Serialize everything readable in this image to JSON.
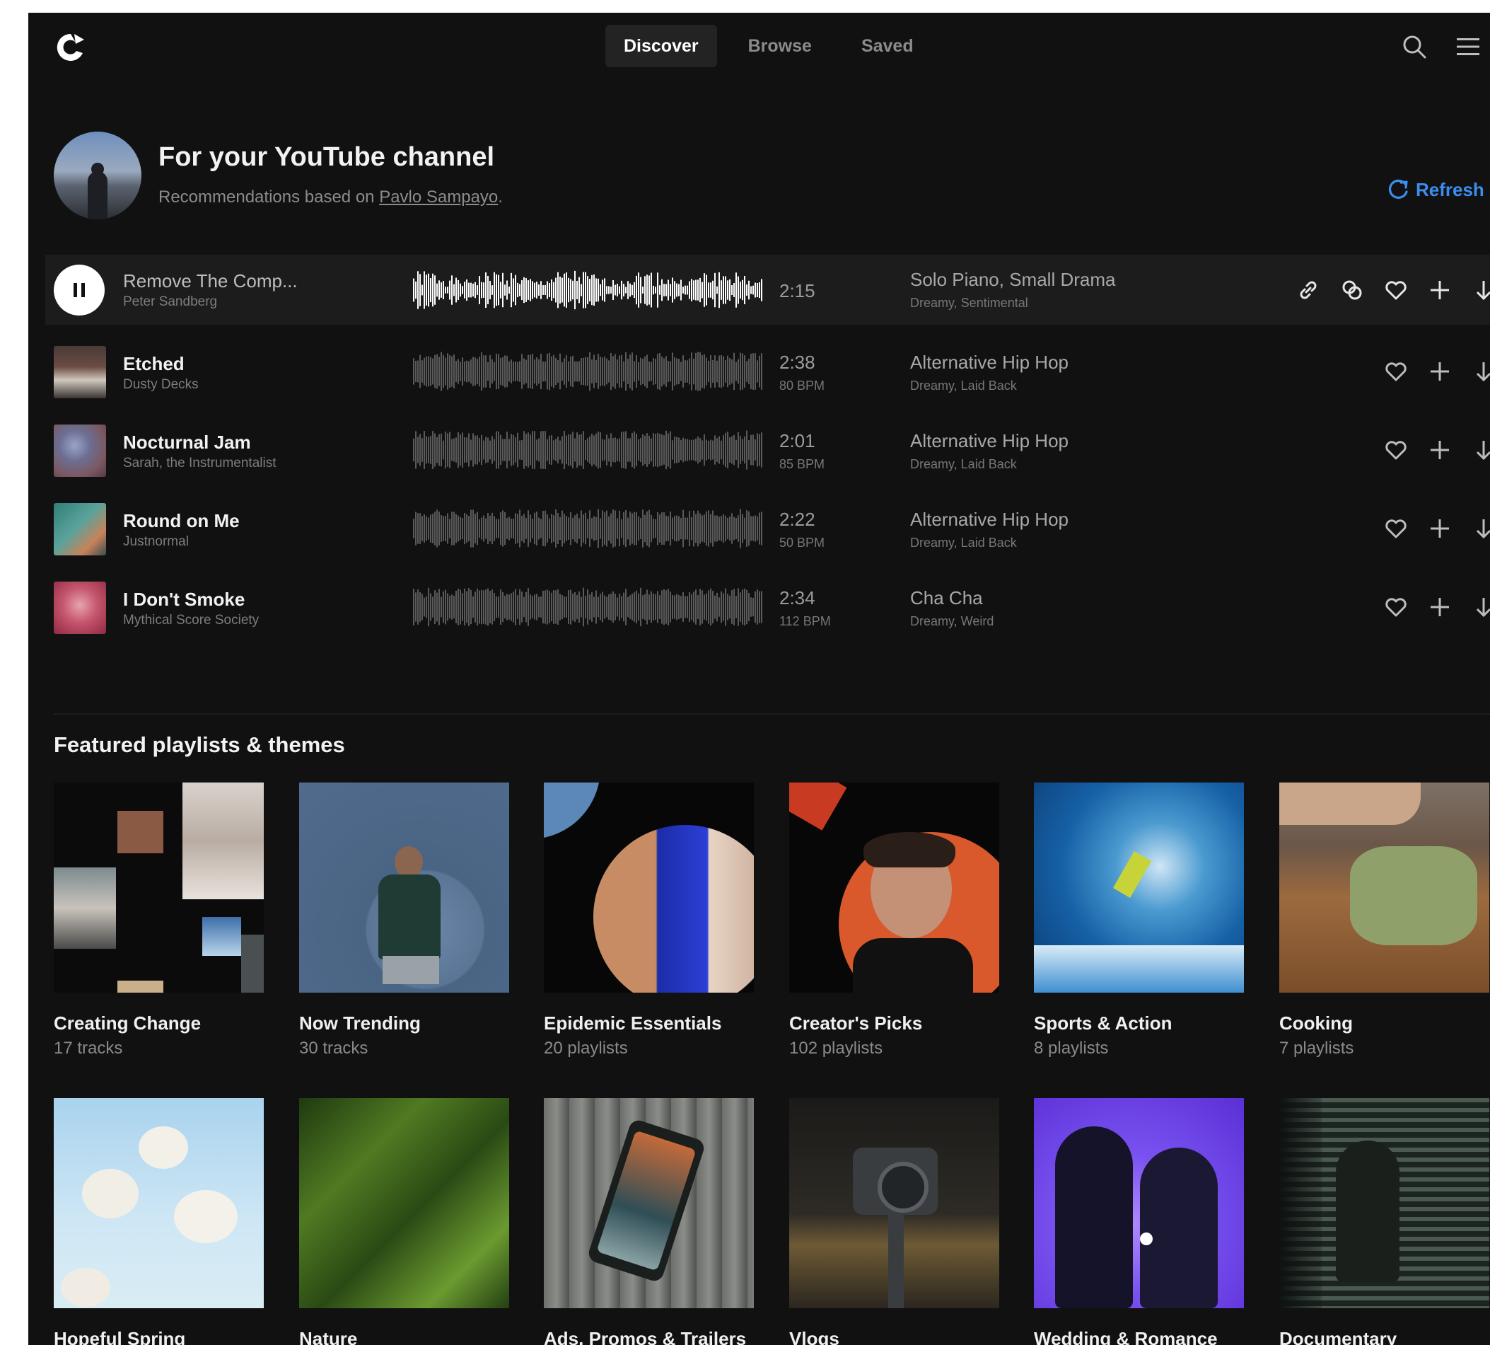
{
  "nav": {
    "tabs": [
      {
        "label": "Discover",
        "active": true
      },
      {
        "label": "Browse",
        "active": false
      },
      {
        "label": "Saved",
        "active": false
      }
    ]
  },
  "header": {
    "title": "For your YouTube channel",
    "subtitle_prefix": "Recommendations based on ",
    "subtitle_link": "Pavlo Sampayo",
    "subtitle_suffix": ".",
    "refresh_label": "Refresh"
  },
  "colors": {
    "background": "#111111",
    "accent": "#3b8ef0",
    "playing_row": "#1c1c1c"
  },
  "tracks": [
    {
      "title": "Remove The Comp...",
      "artist": "Peter Sandberg",
      "duration": "2:15",
      "bpm": "",
      "genre": "Solo Piano, Small Drama",
      "mood": "Dreamy, Sentimental",
      "playing": true
    },
    {
      "title": "Etched",
      "artist": "Dusty Decks",
      "duration": "2:38",
      "bpm": "80 BPM",
      "genre": "Alternative Hip Hop",
      "mood": "Dreamy, Laid Back",
      "playing": false
    },
    {
      "title": "Nocturnal Jam",
      "artist": "Sarah, the Instrumentalist",
      "duration": "2:01",
      "bpm": "85 BPM",
      "genre": "Alternative Hip Hop",
      "mood": "Dreamy, Laid Back",
      "playing": false
    },
    {
      "title": "Round on Me",
      "artist": "Justnormal",
      "duration": "2:22",
      "bpm": "50 BPM",
      "genre": "Alternative Hip Hop",
      "mood": "Dreamy, Laid Back",
      "playing": false
    },
    {
      "title": "I Don't Smoke",
      "artist": "Mythical Score Society",
      "duration": "2:34",
      "bpm": "112 BPM",
      "genre": "Cha Cha",
      "mood": "Dreamy, Weird",
      "playing": false
    }
  ],
  "featured": {
    "title": "Featured playlists & themes",
    "cards": [
      {
        "name": "Creating Change",
        "count": "17 tracks"
      },
      {
        "name": "Now Trending",
        "count": "30 tracks"
      },
      {
        "name": "Epidemic Essentials",
        "count": "20 playlists"
      },
      {
        "name": "Creator's Picks",
        "count": "102 playlists"
      },
      {
        "name": "Sports & Action",
        "count": "8 playlists"
      },
      {
        "name": "Cooking",
        "count": "7 playlists"
      },
      {
        "name": "Hopeful Spring",
        "count": ""
      },
      {
        "name": "Nature",
        "count": ""
      },
      {
        "name": "Ads, Promos & Trailers",
        "count": ""
      },
      {
        "name": "Vlogs",
        "count": ""
      },
      {
        "name": "Wedding & Romance",
        "count": ""
      },
      {
        "name": "Documentary",
        "count": ""
      }
    ]
  }
}
